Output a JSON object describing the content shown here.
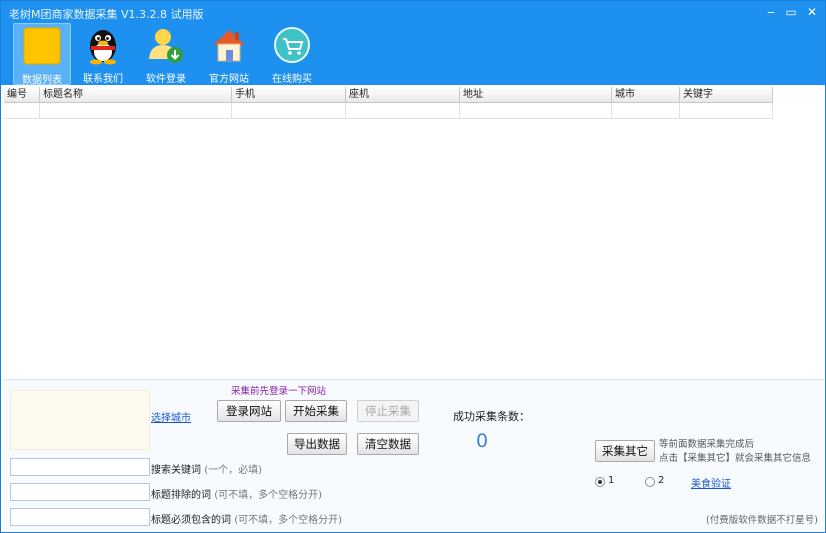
{
  "window": {
    "title": "老树M团商家数据采集 V1.3.2.8 试用版",
    "controls": {
      "minimize": "‒",
      "maximize": "▭",
      "close": "✕"
    }
  },
  "toolbar": {
    "items": [
      {
        "label": "数据列表",
        "icon": "data-list-icon",
        "active": true
      },
      {
        "label": "联系我们",
        "icon": "qq-penguin-icon",
        "active": false
      },
      {
        "label": "软件登录",
        "icon": "user-login-icon",
        "active": false
      },
      {
        "label": "官方网站",
        "icon": "home-icon",
        "active": false
      },
      {
        "label": "在线购买",
        "icon": "shopping-cart-icon",
        "active": false
      }
    ]
  },
  "table": {
    "columns": [
      "编号",
      "标题名称",
      "手机",
      "座机",
      "地址",
      "城市",
      "关键字"
    ],
    "rows": []
  },
  "controls": {
    "login_hint": "采集前先登录一下网站",
    "select_city": "选择城市",
    "login_site": "登录网站",
    "start": "开始采集",
    "stop": "停止采集",
    "export": "导出数据",
    "clear": "清空数据",
    "success_label": "成功采集条数：",
    "success_count": "0",
    "collect_other": "采集其它",
    "collect_other_note_1": "等前面数据采集完成后",
    "collect_other_note_2": "点击【采集其它】就会采集其它信息",
    "radio_1": "1",
    "radio_2": "2",
    "radio_selected": "1",
    "verify": "美食验证",
    "paid_note": "(付费版软件数据不打星号)"
  },
  "fields": {
    "keyword": {
      "label": "搜索关键词",
      "hint": "(一个，必填)",
      "value": ""
    },
    "exclude": {
      "label": "标题排除的词",
      "hint": "(可不填，多个空格分开)",
      "value": ""
    },
    "include": {
      "label": "标题必须包含的词",
      "hint": "(可不填，多个空格分开)",
      "value": ""
    }
  },
  "colors": {
    "titlebar": "#1e90ef",
    "accent_link": "#1a56c9",
    "hint_purple": "#8a1aa8",
    "count_blue": "#3b86d6"
  }
}
